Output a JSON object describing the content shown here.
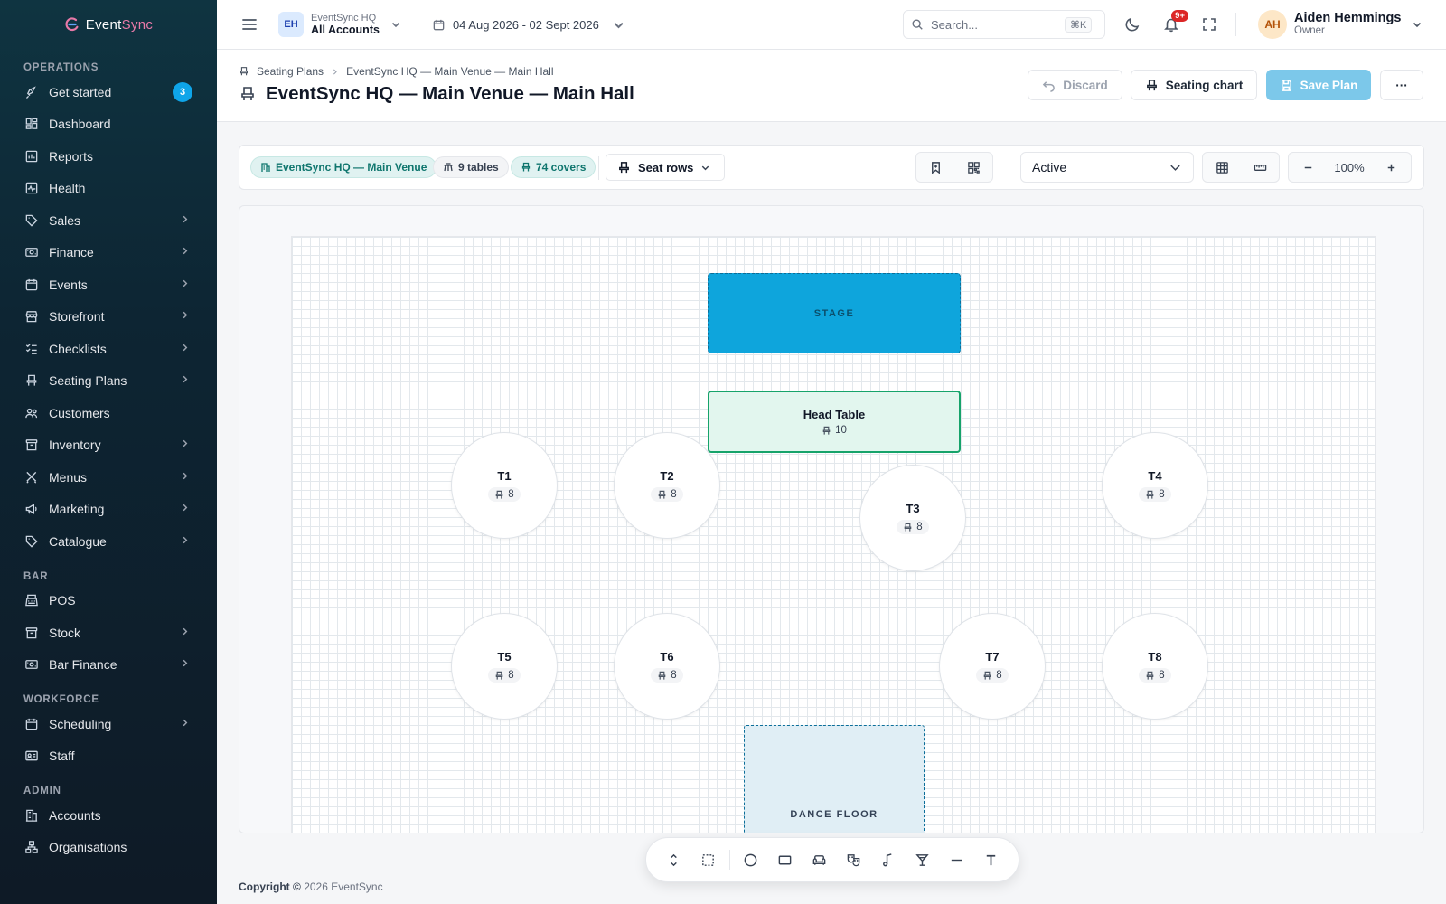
{
  "app": {
    "brand_a": "Event",
    "brand_b": "Sync"
  },
  "sidebar": {
    "sections": [
      {
        "title": "OPERATIONS",
        "items": [
          {
            "label": "Get started",
            "icon": "rocket-icon",
            "badge": "3"
          },
          {
            "label": "Dashboard",
            "icon": "dashboard-icon"
          },
          {
            "label": "Reports",
            "icon": "reports-icon"
          },
          {
            "label": "Health",
            "icon": "health-icon"
          },
          {
            "label": "Sales",
            "icon": "tag-icon",
            "chevron": true
          },
          {
            "label": "Finance",
            "icon": "finance-icon",
            "chevron": true
          },
          {
            "label": "Events",
            "icon": "calendar-icon",
            "chevron": true
          },
          {
            "label": "Storefront",
            "icon": "storefront-icon",
            "chevron": true
          },
          {
            "label": "Checklists",
            "icon": "checklist-icon",
            "chevron": true
          },
          {
            "label": "Seating Plans",
            "icon": "chair-icon",
            "chevron": true
          },
          {
            "label": "Customers",
            "icon": "users-icon"
          },
          {
            "label": "Inventory",
            "icon": "box-icon",
            "chevron": true
          },
          {
            "label": "Menus",
            "icon": "utensils-icon",
            "chevron": true
          },
          {
            "label": "Marketing",
            "icon": "megaphone-icon",
            "chevron": true
          },
          {
            "label": "Catalogue",
            "icon": "tag-icon",
            "chevron": true
          }
        ]
      },
      {
        "title": "BAR",
        "items": [
          {
            "label": "POS",
            "icon": "pos-icon"
          },
          {
            "label": "Stock",
            "icon": "box-icon",
            "chevron": true
          },
          {
            "label": "Bar Finance",
            "icon": "finance-icon",
            "chevron": true
          }
        ]
      },
      {
        "title": "WORKFORCE",
        "items": [
          {
            "label": "Scheduling",
            "icon": "calendar-icon",
            "chevron": true
          },
          {
            "label": "Staff",
            "icon": "id-card-icon"
          }
        ]
      },
      {
        "title": "ADMIN",
        "items": [
          {
            "label": "Accounts",
            "icon": "building-icon"
          },
          {
            "label": "Organisations",
            "icon": "organisation-icon"
          }
        ]
      }
    ]
  },
  "topbar": {
    "account_initials": "EH",
    "account_org": "EventSync HQ",
    "account_name": "All Accounts",
    "date_range": "04 Aug 2026 - 02 Sept 2026",
    "search_placeholder": "Search...",
    "search_shortcut": "⌘K",
    "notifications_badge": "9+",
    "user_initials": "AH",
    "user_name": "Aiden Hemmings",
    "user_role": "Owner"
  },
  "page": {
    "breadcrumb_root": "Seating Plans",
    "breadcrumb_current": "EventSync HQ — Main Venue — Main Hall",
    "title": "EventSync HQ — Main Venue — Main Hall",
    "discard_label": "Discard",
    "seating_chart_label": "Seating chart",
    "save_label": "Save Plan",
    "more_label": "···"
  },
  "toolbar": {
    "venue_chip": "EventSync HQ — Main Venue",
    "tables_chip": "9 tables",
    "covers_chip": "74 covers",
    "seat_rows_label": "Seat rows",
    "status_value": "Active",
    "zoom_value": "100%"
  },
  "floorplan": {
    "stage_label": "STAGE",
    "head_table": {
      "label": "Head Table",
      "seats": "10"
    },
    "tables": [
      {
        "label": "T1",
        "seats": "8"
      },
      {
        "label": "T2",
        "seats": "8"
      },
      {
        "label": "T3",
        "seats": "8"
      },
      {
        "label": "T4",
        "seats": "8"
      },
      {
        "label": "T5",
        "seats": "8"
      },
      {
        "label": "T6",
        "seats": "8"
      },
      {
        "label": "T7",
        "seats": "8"
      },
      {
        "label": "T8",
        "seats": "8"
      }
    ],
    "dance_floor_label": "DANCE FLOOR"
  },
  "footer": {
    "copyright_bold": "Copyright ©",
    "copyright_rest": "2026 EventSync"
  },
  "colors": {
    "accent": "#0ea5e9",
    "stage": "#0ea5dc",
    "head_table_border": "#16a36a",
    "save_button": "#7cc8ea"
  }
}
